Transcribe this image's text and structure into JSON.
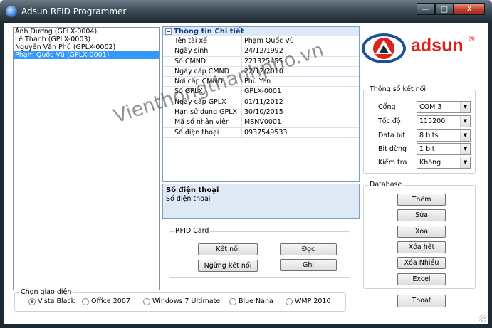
{
  "window": {
    "title": "Adsun RFID Programmer",
    "minimize_glyph": "—",
    "maximize_glyph": "□",
    "close_glyph": "X"
  },
  "list": {
    "items": [
      {
        "label": "Ánh Dương (GPLX-0004)",
        "selected": false
      },
      {
        "label": "Lê Thanh (GPLX-0003)",
        "selected": false
      },
      {
        "label": "Nguyễn Văn Phú (GPLX-0002)",
        "selected": false
      },
      {
        "label": "Phạm Quốc Vũ (GPLX-0001)",
        "selected": true
      }
    ]
  },
  "details": {
    "header": "Thông tin Chi tiết",
    "collapse_glyph": "−",
    "rows": [
      {
        "key": "Tên tài xế",
        "value": "Phạm Quốc Vũ"
      },
      {
        "key": "Ngày sinh",
        "value": "24/12/1992"
      },
      {
        "key": "Số CMND",
        "value": "221325455"
      },
      {
        "key": "Ngày cấp CMND",
        "value": "22/12/2010"
      },
      {
        "key": "Nơi cấp CMND",
        "value": "Phú Yên"
      },
      {
        "key": "Số GPLX",
        "value": "GPLX-0001"
      },
      {
        "key": "Ngày cấp GPLX",
        "value": "01/11/2012"
      },
      {
        "key": "Hạn sử dụng GPLX",
        "value": "30/10/2015"
      },
      {
        "key": "Mã số nhân viên",
        "value": "MSNV0001"
      },
      {
        "key": "Số điện thoại",
        "value": "0937549533"
      }
    ],
    "description_title": "Số điện thoại",
    "description_text": "Số điện thoại"
  },
  "rfid": {
    "group_label": "RFID Card",
    "connect": "Kết nối",
    "disconnect": "Ngừng kết nối",
    "read": "Đọc",
    "write": "Ghi"
  },
  "logo": {
    "text": "adsun",
    "registered": "®",
    "red": "#e0201a",
    "blue": "#1c4f9c"
  },
  "connection": {
    "group_label": "Thông số kết nối",
    "fields": [
      {
        "label": "Cổng",
        "value": "COM 3"
      },
      {
        "label": "Tốc độ",
        "value": "115200"
      },
      {
        "label": "Data bit",
        "value": "8 bits"
      },
      {
        "label": "Bit dừng",
        "value": "1 bit"
      },
      {
        "label": "Kiểm tra",
        "value": "Không"
      }
    ],
    "arrow_glyph": "▼"
  },
  "database": {
    "group_label": "Database",
    "buttons": [
      "Thêm",
      "Sửa",
      "Xóa",
      "Xóa hết",
      "Xóa Nhiều",
      "Excel"
    ]
  },
  "exit_button": "Thoát",
  "theme": {
    "group_label": "Chọn giao diện",
    "options": [
      {
        "label": "Vista Black",
        "selected": true
      },
      {
        "label": "Office 2007",
        "selected": false
      },
      {
        "label": "Windows 7 Ultimate",
        "selected": false
      },
      {
        "label": "Blue Nana",
        "selected": false
      },
      {
        "label": "WMP 2010",
        "selected": false
      }
    ]
  },
  "watermark": "Vienthongthanhpho.vn"
}
